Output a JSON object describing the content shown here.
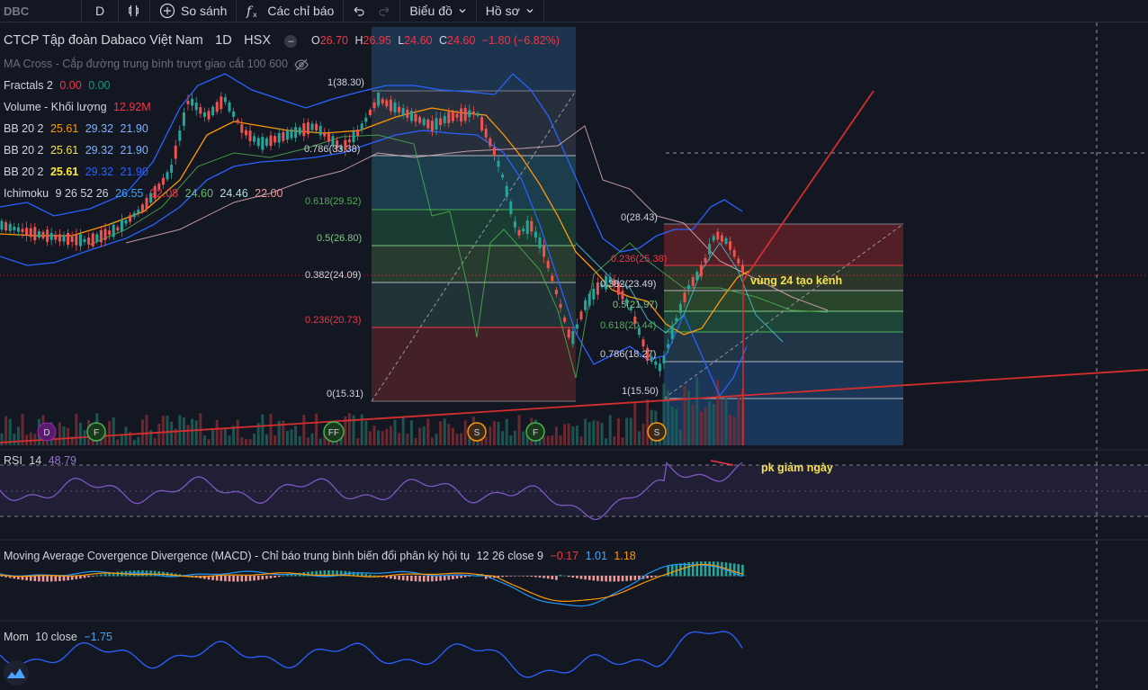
{
  "toolbar": {
    "symbol": "DBC",
    "interval": "D",
    "compare_label": "So sánh",
    "indicators_label": "Các chỉ báo",
    "chart_type_label": "Biểu đồ",
    "profile_label": "Hồ sơ"
  },
  "main_legend": {
    "title": "CTCP Tập đoàn Dabaco Việt Nam",
    "interval": "1D",
    "exchange": "HSX",
    "o_label": "O",
    "o": "26.70",
    "h_label": "H",
    "h": "26.95",
    "l_label": "L",
    "l": "24.60",
    "c_label": "C",
    "c": "24.60",
    "change": "−1.80 (−6.82%)",
    "ma_cross": "MA Cross - Cắp đường trung bình trượt giao cắt 100 600",
    "fractals": {
      "label": "Fractals 2",
      "v1": "0.00",
      "v2": "0.00"
    },
    "volume": {
      "label": "Volume - Khối lượng",
      "v": "12.92M"
    },
    "bb": [
      {
        "label": "BB 20 2",
        "v1": "25.61",
        "v2": "29.32",
        "v3": "21.90"
      },
      {
        "label": "BB 20 2",
        "v1": "25.61",
        "v2": "29.32",
        "v3": "21.90"
      },
      {
        "label": "BB 20 2",
        "v1": "25.61",
        "v2": "29.32",
        "v3": "21.90"
      }
    ],
    "ichimoku": {
      "label": "Ichimoku",
      "params": "9 26 52 26",
      "v1": "26.55",
      "v2": "22.08",
      "v3": "24.60",
      "v4": "24.46",
      "v5": "22.00"
    }
  },
  "fib_left": {
    "levels": [
      {
        "label": "1(38.30)",
        "color": "#b2b5be"
      },
      {
        "label": "0.786(33.38)",
        "color": "#b2b5be"
      },
      {
        "label": "0.618(29.52)",
        "color": "#4caf50"
      },
      {
        "label": "0.5(26.80)",
        "color": "#81c784"
      },
      {
        "label": "0.382(24.09)",
        "color": "#b2b5be"
      },
      {
        "label": "0.236(20.73)",
        "color": "#f23645"
      },
      {
        "label": "0(15.31)",
        "color": "#b2b5be"
      }
    ]
  },
  "fib_right": {
    "levels": [
      {
        "label": "0(28.43)",
        "color": "#b2b5be"
      },
      {
        "label": "0.236(25.38)",
        "color": "#f23645"
      },
      {
        "label": "0.382(23.49)",
        "color": "#b2b5be"
      },
      {
        "label": "0.5(21.97)",
        "color": "#81c784"
      },
      {
        "label": "0.618(20.44)",
        "color": "#4caf50"
      },
      {
        "label": "0.786(18.27)",
        "color": "#b2b5be"
      },
      {
        "label": "1(15.50)",
        "color": "#b2b5be"
      }
    ]
  },
  "annotations": {
    "channel": "vùng 24 tạo kênh",
    "rsi_note": "pk giảm ngày"
  },
  "event_markers": [
    "D",
    "F",
    "FF",
    "S",
    "F",
    "S"
  ],
  "rsi": {
    "label": "RSI",
    "param": "14",
    "value": "48.79"
  },
  "macd": {
    "label": "Moving Average Covergence Divergence (MACD) - Chỉ báo trung bình biến đổi phân kỳ hội tụ",
    "params": "12 26 close 9",
    "v1": "−0.17",
    "v2": "1.01",
    "v3": "1.18"
  },
  "mom": {
    "label": "Mom",
    "params": "10 close",
    "value": "−1.75"
  },
  "colors": {
    "background": "#131722",
    "bullish": "#089981",
    "bearish": "#f23645",
    "bb_band": "#2962ff",
    "rsi": "#7e57c2",
    "annotation": "#f5e14d"
  },
  "icons": [
    "bar-chart-icon",
    "plus-circle-icon",
    "fx-icon",
    "undo-icon",
    "redo-icon",
    "chevron-down-icon",
    "eye-off-icon",
    "tradingview-logo-icon"
  ]
}
